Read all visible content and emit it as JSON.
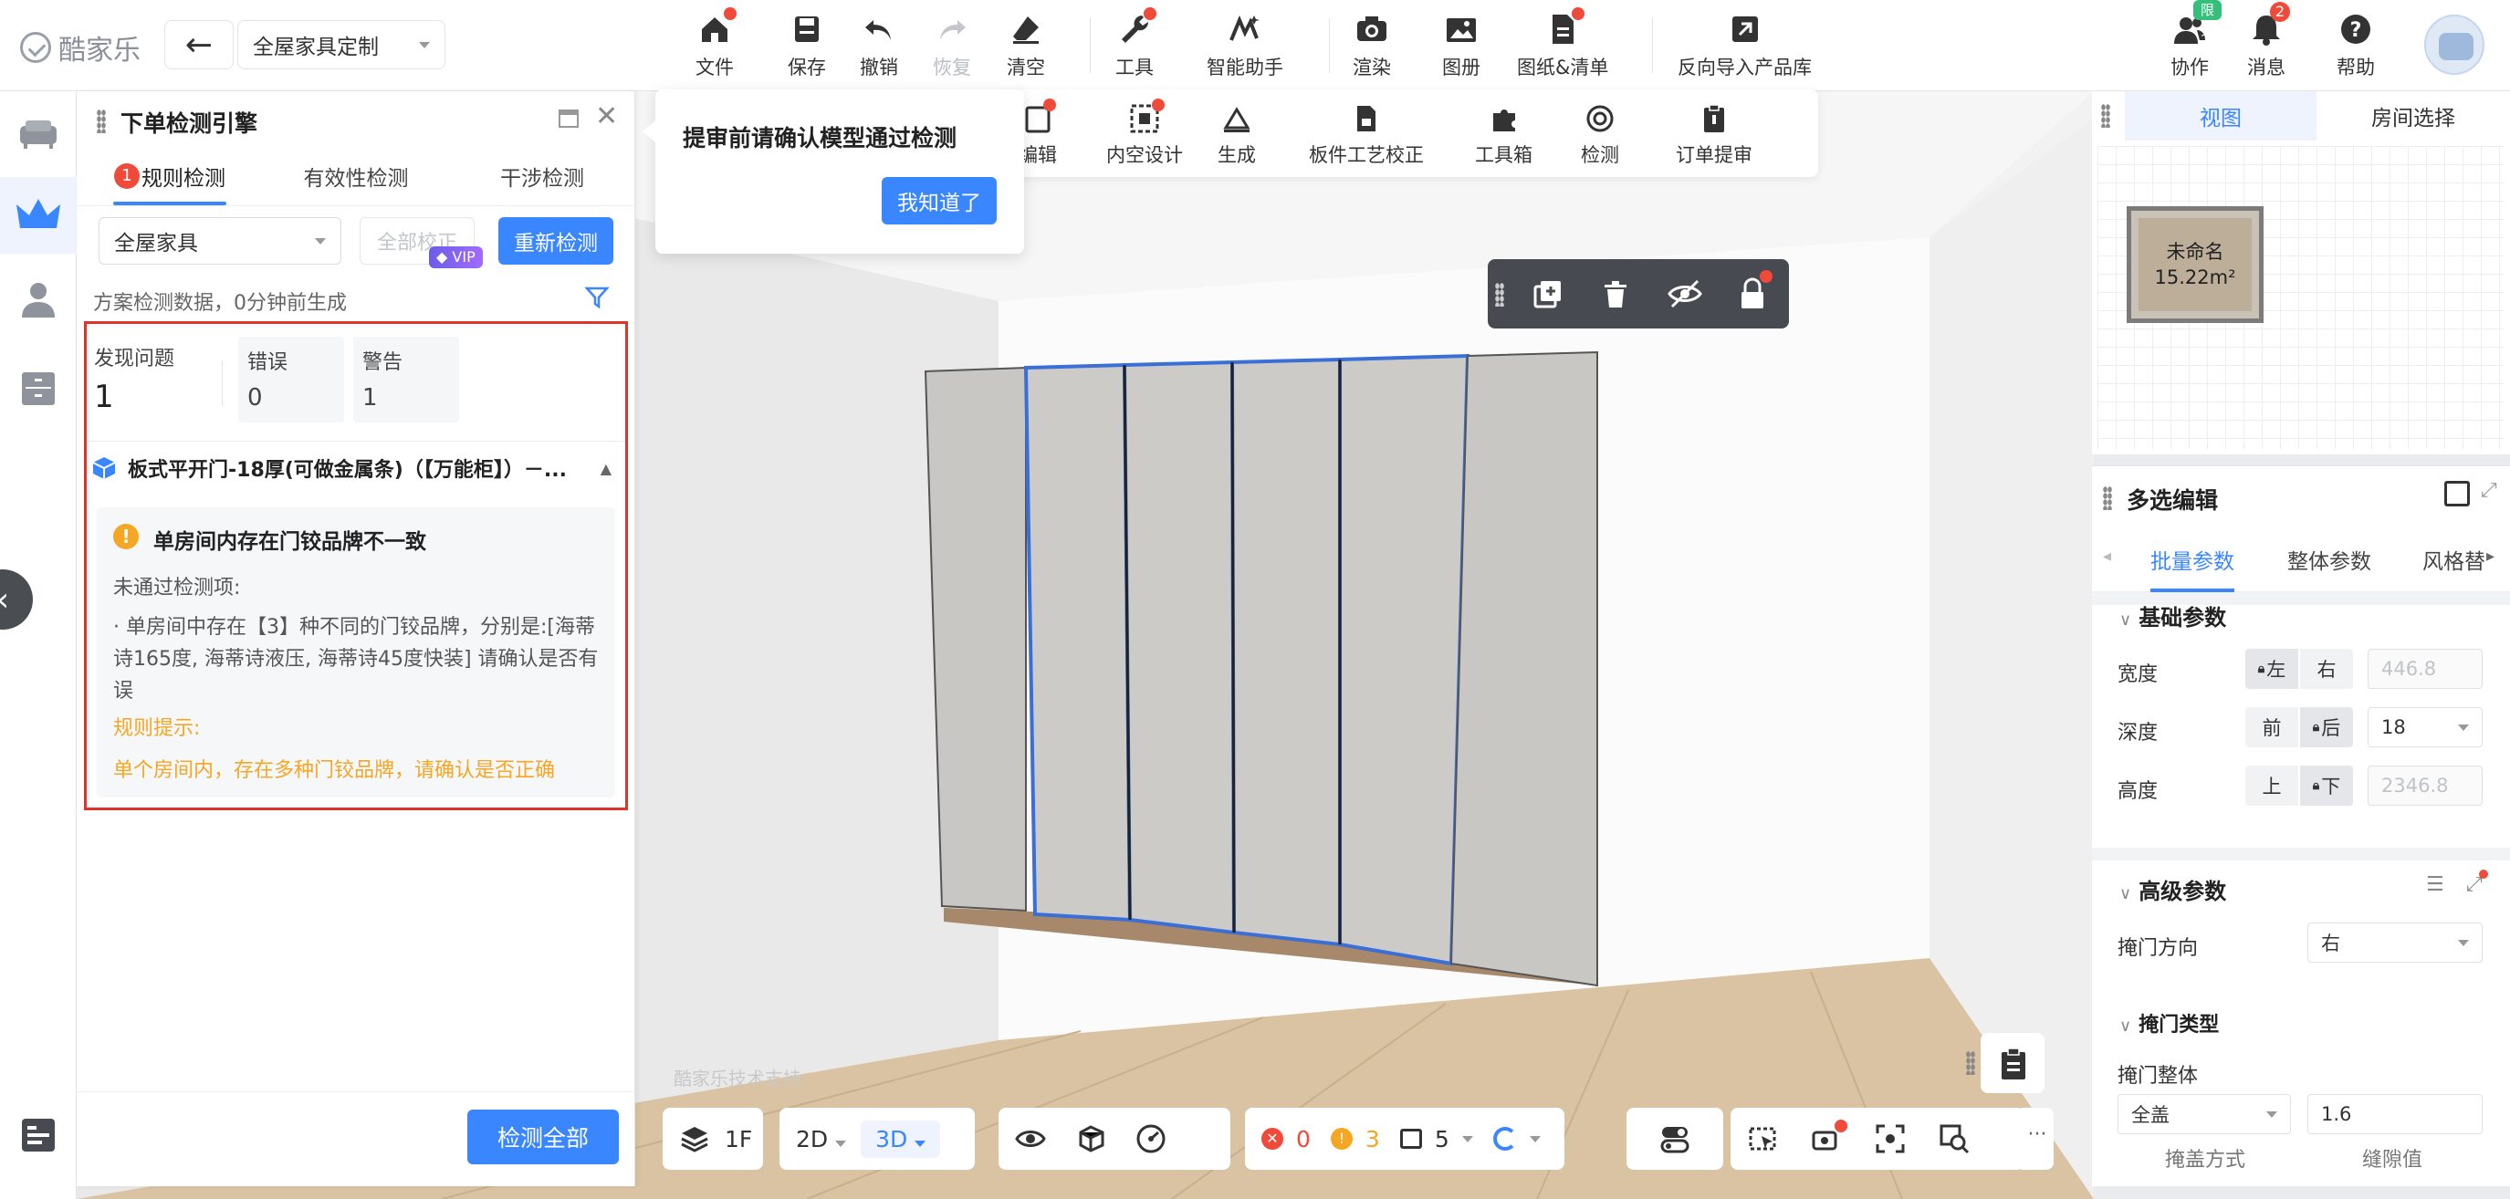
{
  "app": {
    "logo_text": "酷家乐",
    "scheme_name": "全屋家具定制"
  },
  "toolbar": [
    {
      "label": "文件",
      "icon": "home-icon",
      "dot": true
    },
    {
      "label": "保存",
      "icon": "save-icon"
    },
    {
      "label": "撤销",
      "icon": "undo-icon"
    },
    {
      "label": "恢复",
      "icon": "redo-icon",
      "disabled": true
    },
    {
      "label": "清空",
      "icon": "eraser-icon",
      "dot": true
    },
    {
      "label": "工具",
      "icon": "wrench-icon",
      "dot": true
    },
    {
      "label": "智能助手",
      "icon": "magic-icon"
    },
    {
      "label": "渲染",
      "icon": "camera-icon"
    },
    {
      "label": "图册",
      "icon": "gallery-icon"
    },
    {
      "label": "图纸&清单",
      "icon": "document-icon",
      "dot": true
    },
    {
      "label": "反向导入产品库",
      "icon": "import-icon"
    },
    {
      "label": "协作",
      "icon": "users-icon",
      "badge": "限免"
    },
    {
      "label": "消息",
      "icon": "bell-icon",
      "badge": "2"
    },
    {
      "label": "帮助",
      "icon": "help-icon"
    }
  ],
  "check_panel": {
    "title": "下单检测引擎",
    "tabs": [
      {
        "label": "规则检测",
        "badge": "1"
      },
      {
        "label": "有效性检测"
      },
      {
        "label": "干涉检测"
      }
    ],
    "scope_select": "全屋家具",
    "fix_all_label": "全部校正",
    "vip_label": "VIP",
    "recheck_label": "重新检测",
    "gen_text": "方案检测数据，0分钟前生成",
    "stats": {
      "found_label": "发现问题",
      "found_value": "1",
      "error_label": "错误",
      "error_value": "0",
      "warn_label": "警告",
      "warn_value": "1"
    },
    "item_name": "板式平开门-18厚(可做金属条)（【万能柜】）－...",
    "issue": {
      "title": "单房间内存在门铰品牌不一致",
      "sub": "未通过检测项:",
      "desc": "· 单房间中存在【3】种不同的门铰品牌，分别是:[海蒂诗165度, 海蒂诗液压, 海蒂诗45度快装] 请确认是否有误",
      "rule_label": "规则提示:",
      "rule_text": "单个房间内，存在多种门铰品牌，请确认是否正确"
    },
    "check_all_label": "检测全部"
  },
  "tooltip": {
    "text": "提审前请确认模型通过检测",
    "button": "我知道了"
  },
  "subbar": [
    {
      "label": "编辑",
      "icon": "edit-icon",
      "dot": true
    },
    {
      "label": "内空设计",
      "icon": "inner-space-icon",
      "dot": true
    },
    {
      "label": "生成",
      "icon": "generate-icon"
    },
    {
      "label": "板件工艺校正",
      "icon": "board-icon"
    },
    {
      "label": "工具箱",
      "icon": "puzzle-icon"
    },
    {
      "label": "检测",
      "icon": "gauge-icon"
    },
    {
      "label": "订单提审",
      "icon": "clipboard-icon"
    }
  ],
  "view_panel": {
    "tabs": [
      "视图",
      "房间选择"
    ],
    "room_name": "未命名",
    "room_area": "15.22m²"
  },
  "multi_panel": {
    "title": "多选编辑",
    "tabs": [
      "批量参数",
      "整体参数",
      "风格替"
    ],
    "basic_title": "基础参数",
    "width_label": "宽度",
    "width_left": "左",
    "width_right": "右",
    "width_value": "446.8",
    "depth_label": "深度",
    "depth_front": "前",
    "depth_back": "后",
    "depth_value": "18",
    "height_label": "高度",
    "height_up": "上",
    "height_down": "下",
    "height_value": "2346.8",
    "advanced_title": "高级参数",
    "door_dir_label": "掩门方向",
    "door_dir_value": "右",
    "door_type_title": "掩门类型",
    "door_whole_label": "掩门整体",
    "cover_value": "全盖",
    "gap_value": "1.6",
    "cover_caption": "掩盖方式",
    "gap_caption": "缝隙值"
  },
  "bottom": {
    "floor": "1F",
    "mode_2d": "2D",
    "mode_3d": "3D",
    "err_count": "0",
    "warn_count": "3",
    "layer_count": "5"
  },
  "watermark": "酷家乐技术支持",
  "colors": {
    "accent": "#3a86ff",
    "error": "#e0342a",
    "warning": "#f5a623"
  }
}
